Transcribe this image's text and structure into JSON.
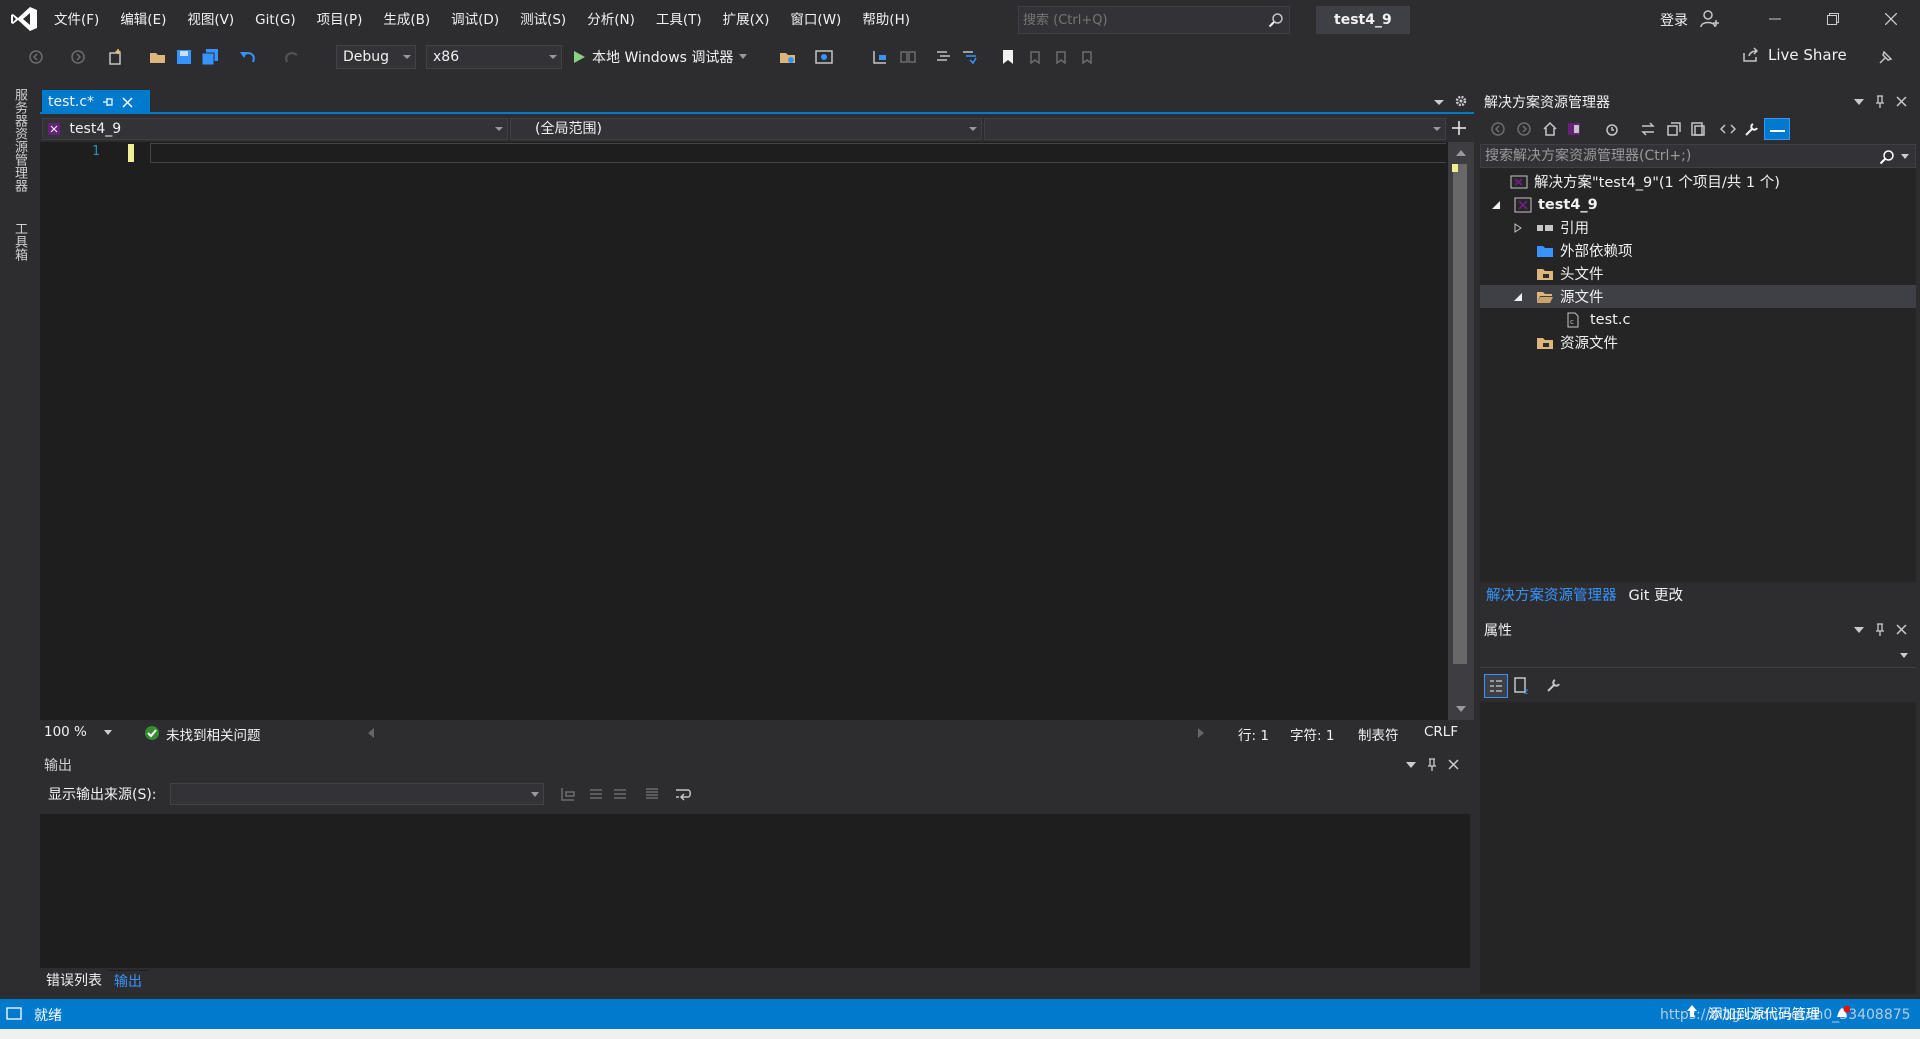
{
  "titlebar": {
    "menu": [
      "文件(F)",
      "编辑(E)",
      "视图(V)",
      "Git(G)",
      "项目(P)",
      "生成(B)",
      "调试(D)",
      "测试(S)",
      "分析(N)",
      "工具(T)",
      "扩展(X)",
      "窗口(W)",
      "帮助(H)"
    ],
    "search_placeholder": "搜索 (Ctrl+Q)",
    "solution_name": "test4_9",
    "signin": "登录"
  },
  "toolbar": {
    "configuration": "Debug",
    "platform": "x86",
    "run_label": "本地 Windows 调试器",
    "live_share": "Live Share"
  },
  "left_tabs": [
    "服务器资源管理器",
    "工具箱"
  ],
  "editor": {
    "tab_label": "test.c*",
    "nav_project": "test4_9",
    "nav_scope": "(全局范围)",
    "nav_member": "",
    "line_number": "1",
    "zoom": "100 %",
    "issues": "未找到相关问题",
    "line": "行: 1",
    "char": "字符: 1",
    "tabs_mode": "制表符",
    "line_ending": "CRLF"
  },
  "output": {
    "title": "输出",
    "source_label": "显示输出来源(S):",
    "source_value": ""
  },
  "bottom_tabs": [
    "错误列表",
    "输出"
  ],
  "solution_explorer": {
    "title": "解决方案资源管理器",
    "search_placeholder": "搜索解决方案资源管理器(Ctrl+;)",
    "tree": [
      {
        "label": "解决方案\"test4_9\"(1 个项目/共 1 个)",
        "level": 0,
        "icon": "solution-icon",
        "expander": "none"
      },
      {
        "label": "test4_9",
        "level": 1,
        "icon": "project-icon",
        "expander": "expanded",
        "bold": true
      },
      {
        "label": "引用",
        "level": 2,
        "icon": "references-icon",
        "expander": "collapsed"
      },
      {
        "label": "外部依赖项",
        "level": 2,
        "icon": "external-deps-icon",
        "expander": "none"
      },
      {
        "label": "头文件",
        "level": 2,
        "icon": "filter-folder-icon",
        "expander": "none"
      },
      {
        "label": "源文件",
        "level": 2,
        "icon": "filter-folder-open-icon",
        "expander": "expanded",
        "selected": true
      },
      {
        "label": "test.c",
        "level": 3,
        "icon": "c-file-icon",
        "expander": "none"
      },
      {
        "label": "资源文件",
        "level": 2,
        "icon": "filter-folder-icon",
        "expander": "none"
      }
    ],
    "tabs": [
      "解决方案资源管理器",
      "Git 更改"
    ]
  },
  "properties": {
    "title": "属性"
  },
  "statusbar": {
    "ready": "就绪",
    "add_source_control": "添加到源代码管理",
    "watermark": "https://blog.csdn.net/m0_53408875"
  },
  "colors": {
    "accent": "#007acc",
    "background": "#2d2d30",
    "editor": "#1e1e1e",
    "link": "#3794ff"
  }
}
